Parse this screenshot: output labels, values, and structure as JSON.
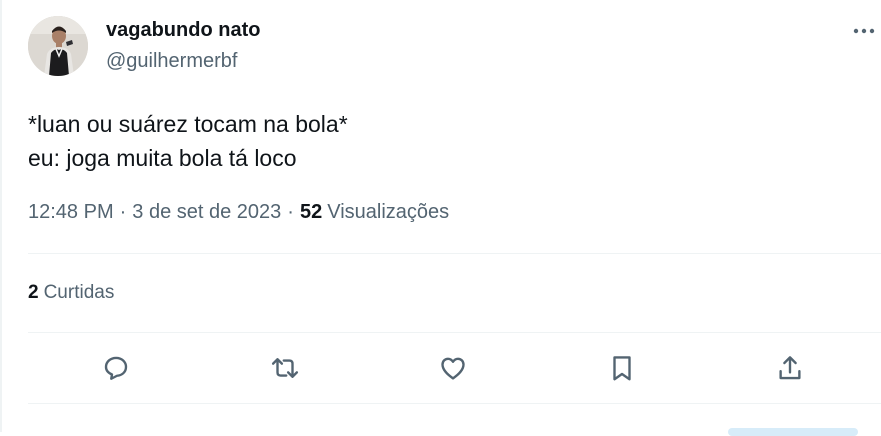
{
  "author": {
    "name": "vagabundo nato",
    "handle": "@guilhermerbf",
    "avatar_icon": "user-avatar"
  },
  "more_icon": "more-horizontal-icon",
  "tweet": {
    "lines": [
      "*luan ou suárez tocam na bola*",
      "eu: joga muita bola tá loco"
    ]
  },
  "meta": {
    "time": "12:48 PM",
    "separator": "·",
    "date": "3 de set de 2023",
    "views_count": "52",
    "views_label": "Visualizações"
  },
  "engagement": {
    "likes_count": "2",
    "likes_label": "Curtidas"
  },
  "actions": [
    {
      "icon": "reply-icon"
    },
    {
      "icon": "retweet-icon"
    },
    {
      "icon": "like-icon"
    },
    {
      "icon": "bookmark-icon"
    },
    {
      "icon": "share-icon"
    }
  ],
  "colors": {
    "text_primary": "#0f1419",
    "text_secondary": "#536471",
    "divider": "#eff3f4"
  }
}
